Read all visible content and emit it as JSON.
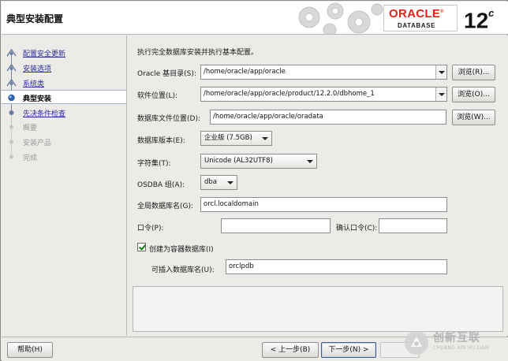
{
  "window": {
    "title": "典型安装配置"
  },
  "branding": {
    "oracle": "ORACLE",
    "database": "DATABASE",
    "version": "12",
    "version_suffix": "c",
    "oracle_color": "#e2231a"
  },
  "nav": {
    "items": [
      {
        "label": "配置安全更新",
        "state": "done"
      },
      {
        "label": "安装选项",
        "state": "done"
      },
      {
        "label": "系统类",
        "state": "done"
      },
      {
        "label": "典型安装",
        "state": "current"
      },
      {
        "label": "先决条件检查",
        "state": "next"
      },
      {
        "label": "概要",
        "state": "future"
      },
      {
        "label": "安装产品",
        "state": "future"
      },
      {
        "label": "完成",
        "state": "future"
      }
    ]
  },
  "form": {
    "intro": "执行完全数据库安装并执行基本配置。",
    "base_dir": {
      "label": "Oracle 基目录(S):",
      "value": "/home/oracle/app/oracle"
    },
    "software_loc": {
      "label": "软件位置(L):",
      "value": "/home/oracle/app/oracle/product/12.2.0/dbhome_1"
    },
    "datafile_loc": {
      "label": "数据库文件位置(D):",
      "value": "/home/oracle/app/oracle/oradata"
    },
    "browse1": "浏览(R)...",
    "browse2": "浏览(O)...",
    "browse3": "浏览(W)...",
    "db_edition": {
      "label": "数据库版本(E):",
      "value": "企业版 (7.5GB)"
    },
    "charset": {
      "label": "字符集(T):",
      "value": "Unicode (AL32UTF8)"
    },
    "osdba": {
      "label": "OSDBA 组(A):",
      "value": "dba"
    },
    "global_db_name": {
      "label": "全局数据库名(G):",
      "value": "orcl.localdomain"
    },
    "password": {
      "label": "口令(P):",
      "value": ""
    },
    "confirm_password": {
      "label": "确认口令(C):",
      "value": ""
    },
    "container_db": {
      "label": "创建为容器数据库(I)",
      "checked": true
    },
    "pdb_name": {
      "label": "可插入数据库名(U):",
      "value": "orclpdb"
    }
  },
  "footer": {
    "help": "帮助(H)",
    "back": "< 上一步(B)",
    "next": "下一步(N) >"
  },
  "watermark": {
    "brand": "创新互联",
    "sub": "CHUANG XIN HU LIAN"
  }
}
